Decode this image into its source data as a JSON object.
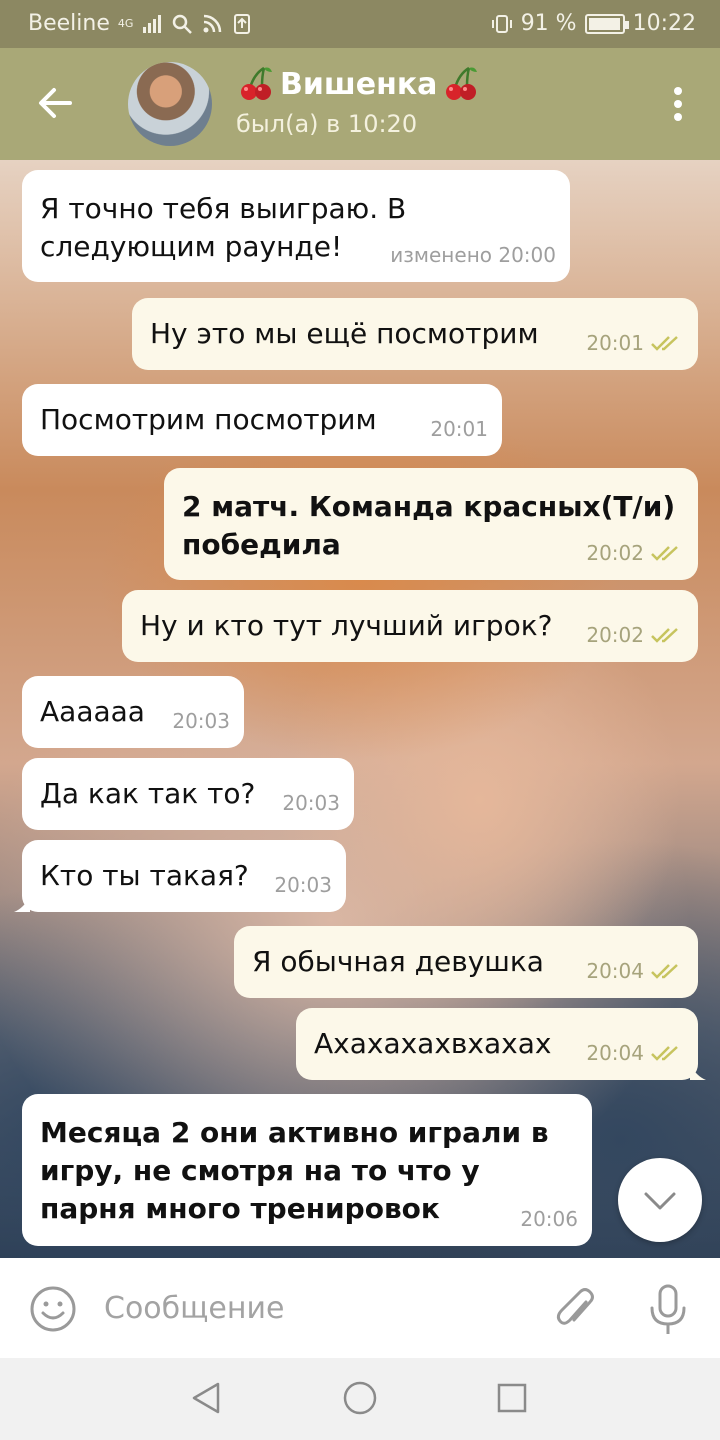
{
  "status_bar": {
    "carrier": "Beeline",
    "network": "4G",
    "battery": "91 %",
    "time": "10:22"
  },
  "header": {
    "title": "Вишенка",
    "title_emoji": "cherries-icon",
    "status": "был(а) в 10:20"
  },
  "messages": [
    {
      "direction": "in",
      "text": "Я точно тебя выиграю. В следующим раунде!",
      "meta": "изменено 20:00"
    },
    {
      "direction": "out",
      "text": "Ну это мы ещё посмотрим",
      "meta": "20:01",
      "read": true
    },
    {
      "direction": "in",
      "text": "Посмотрим посмотрим",
      "meta": "20:01"
    },
    {
      "direction": "out",
      "text": "2 матч. Команда красных(Т/и) победила",
      "meta": "20:02",
      "read": true
    },
    {
      "direction": "out",
      "text": "Ну и кто тут лучший игрок?",
      "meta": "20:02",
      "read": true
    },
    {
      "direction": "in",
      "text": "Аааааа",
      "meta": "20:03"
    },
    {
      "direction": "in",
      "text": "Да как так то?",
      "meta": "20:03"
    },
    {
      "direction": "in",
      "text": "Кто ты такая?",
      "meta": "20:03"
    },
    {
      "direction": "out",
      "text": "Я обычная девушка",
      "meta": "20:04",
      "read": true
    },
    {
      "direction": "out",
      "text": "Ахахахахвхахах",
      "meta": "20:04",
      "read": true
    },
    {
      "direction": "in",
      "text": "Месяца 2 они активно играли в игру, не смотря на то что у парня много тренировок",
      "meta": "20:06"
    }
  ],
  "input": {
    "placeholder": "Сообщение"
  },
  "colors": {
    "header": "#a9a877",
    "status_bar": "#8c8862",
    "bubble_in": "#ffffff",
    "bubble_out": "#fcf8e9",
    "read_check": "#c7c45e"
  }
}
